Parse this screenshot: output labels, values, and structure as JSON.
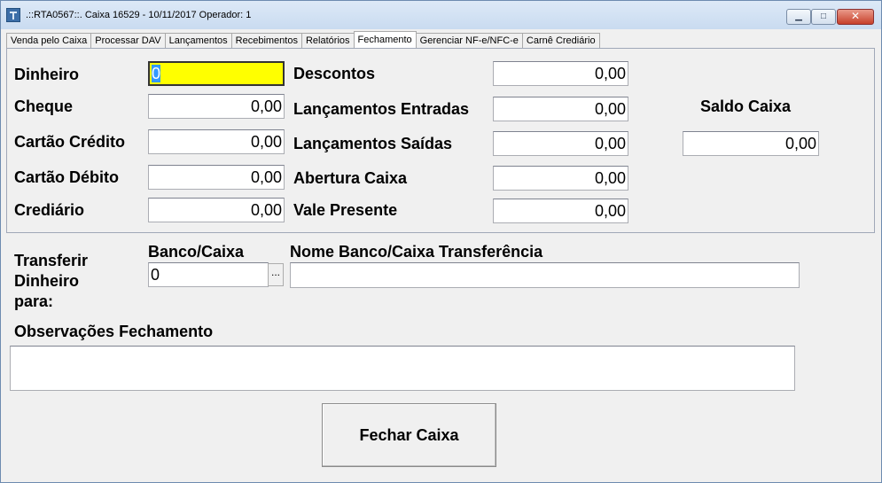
{
  "window": {
    "title": ".::RTA0567::. Caixa 16529 - 10/11/2017 Operador: 1",
    "app_icon": "app-logo-icon",
    "minimize_glyph": "▁",
    "maximize_glyph": "□",
    "close_glyph": "✕"
  },
  "tabs": [
    {
      "label": "Venda pelo Caixa"
    },
    {
      "label": "Processar DAV"
    },
    {
      "label": "Lançamentos"
    },
    {
      "label": "Recebimentos"
    },
    {
      "label": "Relatórios"
    },
    {
      "label": "Fechamento",
      "active": true
    },
    {
      "label": "Gerenciar NF-e/NFC-e"
    },
    {
      "label": "Carnê Crediário"
    }
  ],
  "fechamento": {
    "dinheiro": {
      "label": "Dinheiro",
      "value": "0"
    },
    "cheque": {
      "label": "Cheque",
      "value": "0,00"
    },
    "cartao_credito": {
      "label": "Cartão Crédito",
      "value": "0,00"
    },
    "cartao_debito": {
      "label": "Cartão Débito",
      "value": "0,00"
    },
    "crediario": {
      "label": "Crediário",
      "value": "0,00"
    },
    "descontos": {
      "label": "Descontos",
      "value": "0,00"
    },
    "lancamentos_entradas": {
      "label": "Lançamentos Entradas",
      "value": "0,00"
    },
    "lancamentos_saidas": {
      "label": "Lançamentos Saídas",
      "value": "0,00"
    },
    "abertura_caixa": {
      "label": "Abertura Caixa",
      "value": "0,00"
    },
    "vale_presente": {
      "label": "Vale Presente",
      "value": "0,00"
    },
    "saldo_caixa": {
      "label": "Saldo Caixa",
      "value": "0,00"
    }
  },
  "transferencia": {
    "label_line1": "Transferir",
    "label_line2": "Dinheiro",
    "label_line3": "para:",
    "banco_caixa_label": "Banco/Caixa",
    "banco_caixa_value": "0",
    "lookup_button": "...",
    "nome_label": "Nome Banco/Caixa Transferência",
    "nome_value": ""
  },
  "observacoes": {
    "label": "Observações Fechamento",
    "value": ""
  },
  "actions": {
    "fechar_caixa": "Fechar Caixa"
  },
  "colors": {
    "focused_field": "#ffff00",
    "selection": "#3399ff",
    "titlebar": "#c9dbf0",
    "close_button": "#c7402a"
  }
}
